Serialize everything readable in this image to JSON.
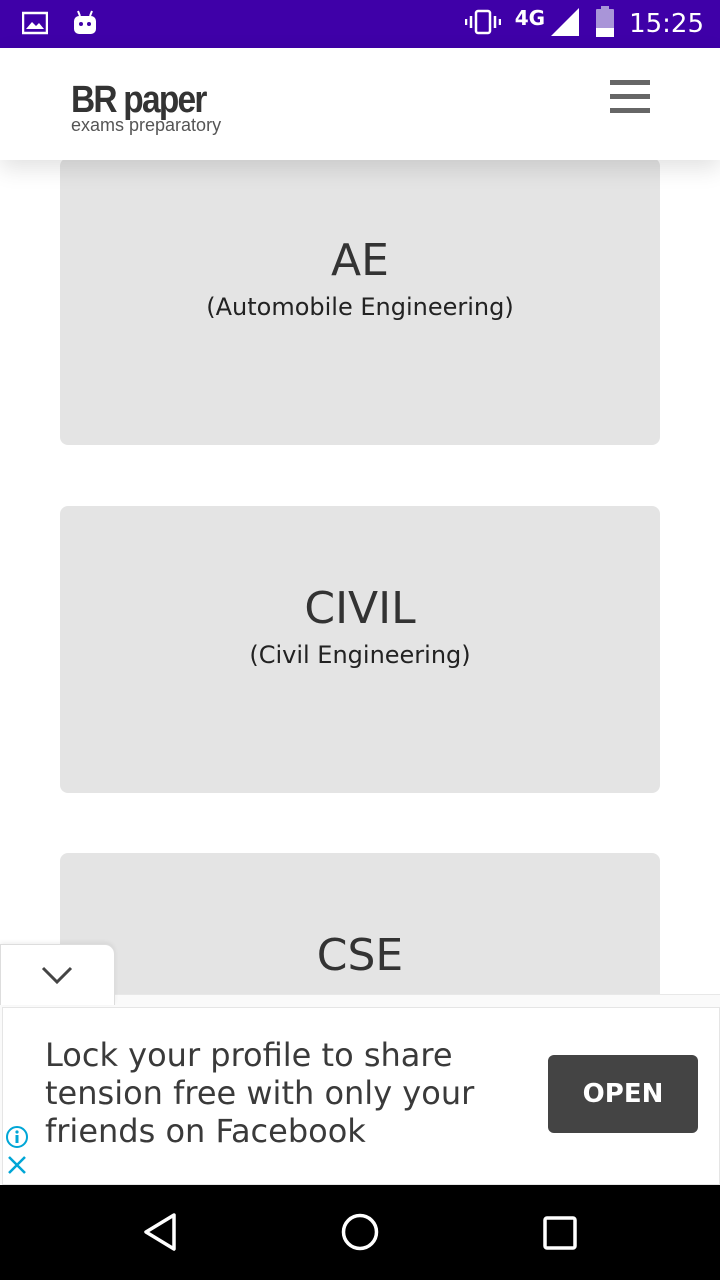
{
  "status_bar": {
    "time": "15:25",
    "network": "4G",
    "icons": [
      "image-icon",
      "android-icon",
      "vibrate-icon",
      "signal-icon",
      "battery-icon"
    ]
  },
  "header": {
    "logo_main": "BR paper",
    "logo_sub": "exams preparatory",
    "menu_icon": "hamburger-menu-icon"
  },
  "cards": [
    {
      "title": "AE",
      "subtitle": "(Automobile Engineering)"
    },
    {
      "title": "CIVIL",
      "subtitle": "(Civil Engineering)"
    },
    {
      "title": "CSE",
      "subtitle": ""
    }
  ],
  "ad": {
    "text": "Lock your profile to share tension free with only your friends on Facebook",
    "button_label": "OPEN",
    "info_icon": "info-icon",
    "close_icon": "close-icon",
    "collapse_icon": "chevron-down-icon"
  },
  "nav_bar": {
    "icons": [
      "back-icon",
      "home-icon",
      "recents-icon"
    ]
  },
  "colors": {
    "status_bar": "#3f00a8",
    "card_bg": "#e4e4e4",
    "ad_button": "#444444",
    "ad_info": "#00a6d6"
  }
}
